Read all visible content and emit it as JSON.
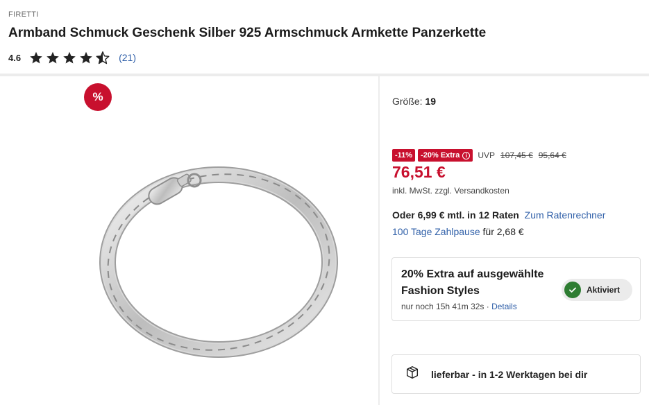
{
  "product": {
    "brand": "FIRETTI",
    "title": "Armband Schmuck Geschenk Silber 925 Armschmuck Armkette Panzerkette",
    "rating": "4.6",
    "rating_stars": 4.5,
    "rating_count": "(21)"
  },
  "gallery": {
    "sale_badge": "%"
  },
  "size": {
    "label": "Größe:",
    "value": "19"
  },
  "pricing": {
    "discount_tag": "-11%",
    "extra_tag": "-20% Extra",
    "info_icon": "info-icon",
    "uvp_label": "UVP",
    "uvp_price": "107,45 €",
    "old_price": "95,64 €",
    "price": "76,51 €",
    "tax_note": "inkl. MwSt. zzgl. Versandkosten",
    "accent_color": "#c8102e"
  },
  "installment": {
    "text": "Oder 6,99 € mtl. in 12 Raten",
    "link": "Zum Ratenrechner"
  },
  "payment_pause": {
    "link": "100 Tage Zahlpause",
    "suffix": "für 2,68 €"
  },
  "promo": {
    "title": "20% Extra auf ausgewählte Fashion Styles",
    "countdown": "nur noch 15h 41m 32s ·",
    "details_link": "Details",
    "toggle_label": "Aktiviert",
    "toggle_color": "#2e7d32"
  },
  "delivery": {
    "icon": "package-icon",
    "text": "lieferbar - in 1-2 Werktagen bei dir"
  },
  "colors": {
    "link": "#2f5fa8",
    "star": "#222222"
  }
}
